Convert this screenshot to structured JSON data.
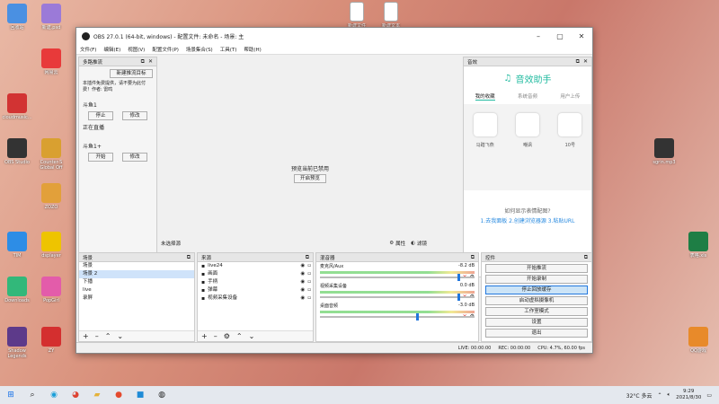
{
  "desktop": {
    "left_icons": [
      {
        "label": "回收站",
        "color": "#4a90e2"
      },
      {
        "label": "新建.psd",
        "color": "#9b7ad8"
      },
      {
        "label": "网易云",
        "color": "#e83a3a"
      },
      {
        "label": "cloudmusic...",
        "color": "#d23333"
      },
      {
        "label": "OBS Studio",
        "color": "#333333"
      },
      {
        "label": "Counter-S Global Off",
        "color": "#d9a030"
      },
      {
        "label": "ZOZO",
        "color": "#e2a03a"
      },
      {
        "label": "TIM",
        "color": "#2d8de6"
      },
      {
        "label": "dsplayer",
        "color": "#eec400"
      },
      {
        "label": "Downloads",
        "color": "#32b87a"
      },
      {
        "label": "PopGirl",
        "color": "#e35caa"
      },
      {
        "label": "Shadow Legends",
        "color": "#5d3a8a"
      },
      {
        "label": "ZY",
        "color": "#d42f2f"
      }
    ],
    "top_icons": [
      {
        "label": "新建文件"
      },
      {
        "label": "新建文本"
      }
    ],
    "right_icons": [
      {
        "label": "sgrin.mp3",
        "color": "#333333"
      },
      {
        "label": "表格.xls",
        "color": "#1e7e45"
      },
      {
        "label": "QQ游戏",
        "color": "#e88a2a"
      }
    ]
  },
  "obs": {
    "title": "OBS 27.0.1 (64-bit, windows) - 配置文件: 未命名 - 场景: 主",
    "menu": [
      "文件(F)",
      "编辑(E)",
      "视图(V)",
      "配置文件(P)",
      "场景集合(S)",
      "工具(T)",
      "帮助(H)"
    ],
    "plugin_panel": {
      "title": "多路推流",
      "new_button": "新建推流目标",
      "note": "本插件免费提供，请不要为此付费！作者: 雷鸣",
      "targets": [
        {
          "name": "斗鱼1",
          "stop": "停止",
          "edit": "修改",
          "status": "正在直播"
        },
        {
          "name": "斗鱼1+",
          "start": "开始",
          "edit": "修改"
        }
      ]
    },
    "preview": {
      "message": "预览当前已禁用",
      "enable_button": "开启预览",
      "unsaved": "未选择源",
      "props": "属性",
      "filters": "滤镜"
    },
    "music_panel": {
      "dock_title": "音效",
      "app_name": "音效助手",
      "tabs": [
        "我的收藏",
        "系统音频",
        "用户上传"
      ],
      "items": [
        {
          "label": "马踏飞燕"
        },
        {
          "label": "嘲讽"
        },
        {
          "label": "10号"
        }
      ],
      "help_title": "如何显示表情配图?",
      "help_steps": "1.去我面板 2.创建浏览器源 3.粘贴URL"
    },
    "scenes": {
      "title": "场景",
      "items": [
        "场景",
        "场景 2",
        "下播",
        "live",
        "录屏"
      ],
      "selected": 1
    },
    "sources": {
      "title": "来源",
      "items": [
        "live24",
        "画面",
        "手柄",
        "弹幕",
        "视频采集设备"
      ]
    },
    "mixer": {
      "title": "混音器",
      "channels": [
        {
          "name": "麦克风/Aux",
          "db": "-8.2 dB",
          "level": 0.89
        },
        {
          "name": "视频采集设备",
          "db": "0.0 dB",
          "level": 0.89
        },
        {
          "name": "桌面音频",
          "db": "-3.0 dB",
          "level": 0.62
        }
      ]
    },
    "controls": {
      "title": "控件",
      "buttons": [
        "开始推流",
        "开始录制",
        "停止回放缓存",
        "启动虚拟摄像机",
        "工作室模式",
        "设置",
        "退出"
      ],
      "active_index": 2
    },
    "status": {
      "live": "LIVE: 00:00:00",
      "rec": "REC: 00:00:00",
      "cpu": "CPU: 4.7%, 60.00 fps"
    }
  },
  "taskbar": {
    "apps": [
      "start",
      "search",
      "edge",
      "chrome",
      "folder",
      "obs-red",
      "word",
      "obs"
    ],
    "weather": "32°C 多云",
    "time": "9:29",
    "date": "2021/8/30"
  }
}
